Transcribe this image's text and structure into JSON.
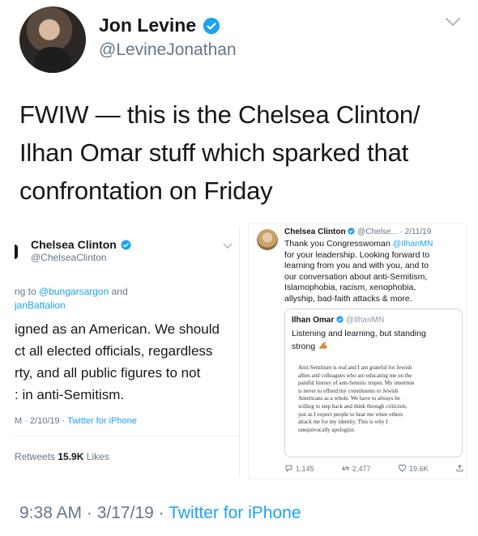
{
  "author": {
    "name": "Jon Levine",
    "handle": "@LevineJonathan"
  },
  "tweet": {
    "text_lines": [
      "FWIW — this is the Chelsea Clinton/",
      "Ilhan Omar stuff which sparked that",
      "confrontation on Friday"
    ],
    "time": "9:38 AM",
    "sep1": " · ",
    "date": "3/17/19",
    "sep2": " · ",
    "source": "Twitter for iPhone"
  },
  "left_card": {
    "name": "Chelsea Clinton",
    "handle": "@ChelseaClinton",
    "reply_prefix": "ng to ",
    "reply_link1": "@bungarsargon",
    "reply_and": " and",
    "reply_link2": "janBattalion",
    "body_lines": [
      "igned as an American. We should",
      "ct all elected officials, regardless",
      "rty, and all public figures to not",
      ": in anti-Semitism."
    ],
    "meta_time": "M · 2/10/19 · ",
    "meta_source": "Twitter for iPhone",
    "retweets_label": "Retweets ",
    "likes_count": "15.9K",
    "likes_label": " Likes"
  },
  "right_card": {
    "name": "Chelsea Clinton",
    "handle_date": "@Chelse... · 2/11/19",
    "body_lines": [
      [
        "Thank you Congresswoman ",
        "@IlhanMN"
      ],
      [
        "for your leadership. Looking forward to",
        ""
      ],
      [
        "learning from you and with you, and to",
        ""
      ],
      [
        "our conversation about anti-Semitism,",
        ""
      ],
      [
        "Islamophobia, racism, xenophobia,",
        ""
      ],
      [
        "allyship, bad-faith attacks & more.",
        ""
      ]
    ],
    "quote": {
      "name": "Ilhan Omar",
      "handle": "@IlhanMN",
      "text_line1": "Listening and learning, but standing",
      "text_line2": "strong",
      "note_lines": [
        "Anti-Semitism is real and I am grateful for Jewish",
        "allies and colleagues who are educating me on the",
        "painful history of anti-Semitic tropes. My intention",
        "is never to offend my constituents or Jewish",
        "Americans as a whole. We have to always be",
        "willing to step back and think through criticism,",
        "just as I expect people to hear me when others",
        "attack me for my identity. This is why I",
        "unequivocally apologize."
      ]
    },
    "replies": "1,145",
    "retweets": "2,477",
    "likes": "19.6K"
  },
  "colors": {
    "brand_blue": "#1da1f2",
    "muted": "#657786"
  },
  "icons": {
    "verified": "verified-badge-icon",
    "caret": "chevron-down-icon",
    "reply": "reply-icon",
    "retweet": "retweet-icon",
    "like": "heart-icon",
    "share": "share-icon",
    "emoji": "flexed-biceps-icon"
  }
}
